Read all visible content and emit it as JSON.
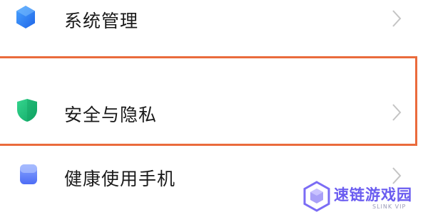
{
  "settings_list": {
    "items": [
      {
        "label": "系统管理",
        "icon": "system-hexagon-icon",
        "icon_color": "#2f7ff0"
      },
      {
        "label": "安全与隐私",
        "icon": "shield-icon",
        "icon_color": "#1fc27a"
      },
      {
        "label": "健康使用手机",
        "icon": "phone-health-icon",
        "icon_color": "#6f8dfc"
      }
    ],
    "chevron_icon": "chevron-right-icon",
    "highlighted_item": "安全与隐私",
    "highlight_color": "#ea6b3c"
  },
  "watermark": {
    "title": "速链游戏园",
    "subtitle": "SLINK VIP",
    "logo_icon": "cube-logo-icon",
    "color": "#6a5cf0"
  }
}
